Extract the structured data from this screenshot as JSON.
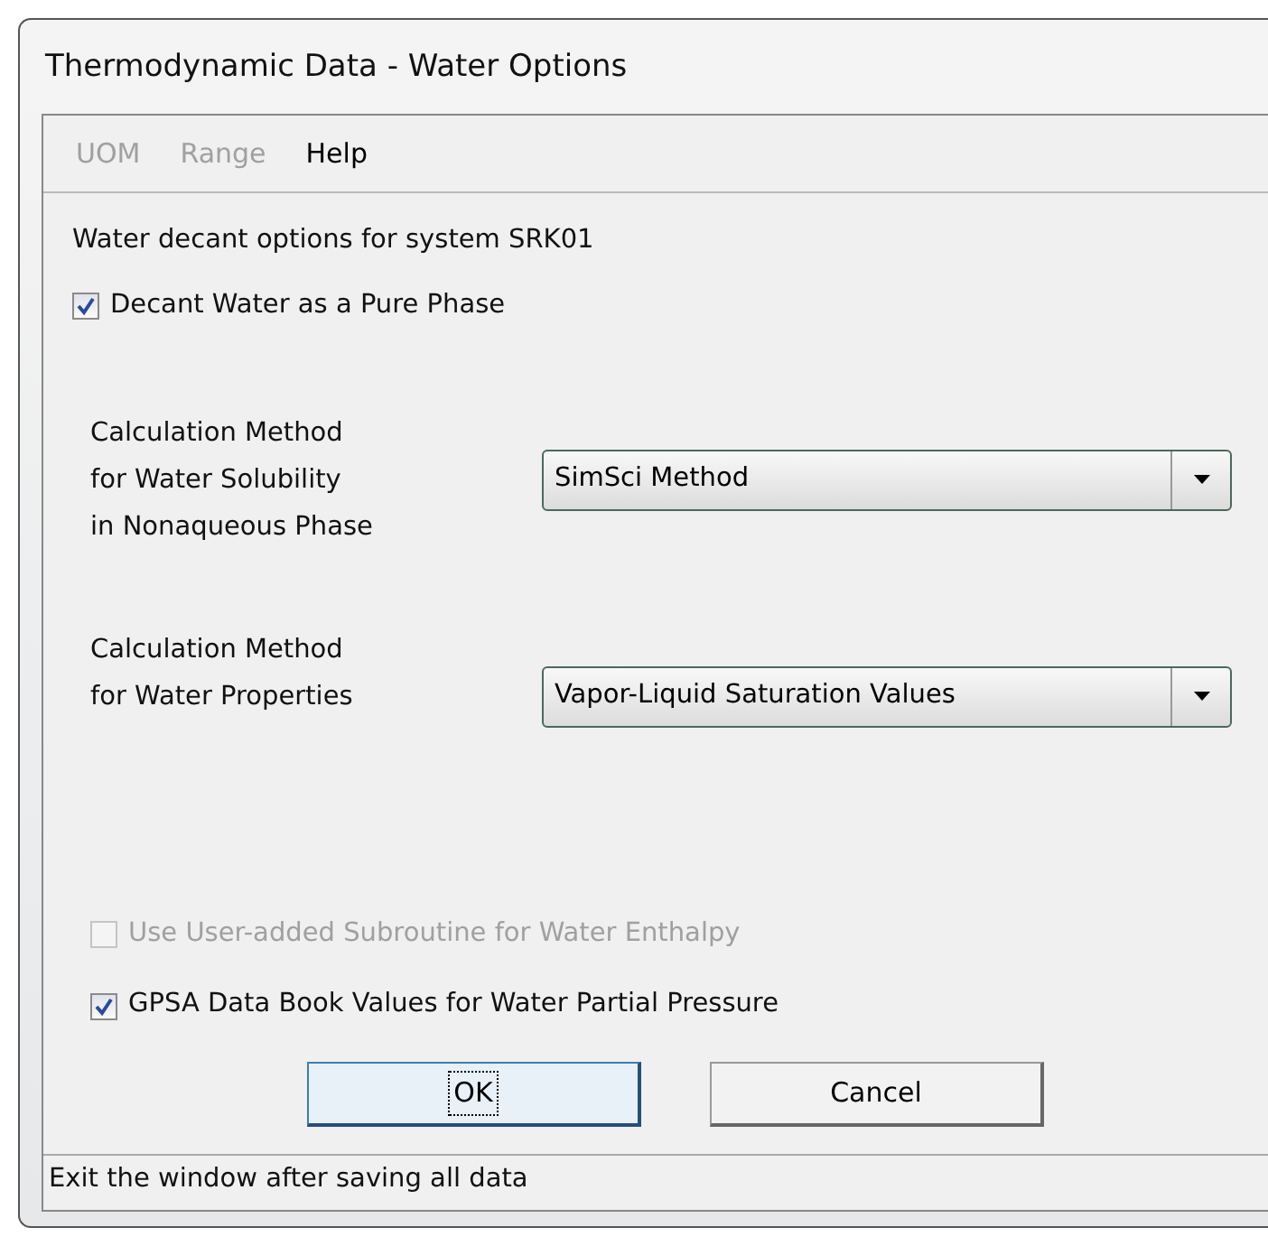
{
  "window": {
    "title": "Thermodynamic Data - Water Options"
  },
  "menu": [
    {
      "label": "UOM",
      "disabled": true
    },
    {
      "label": "Range",
      "disabled": true
    },
    {
      "label": "Help",
      "disabled": false
    }
  ],
  "heading": "Water decant options for system SRK01",
  "decant": {
    "label": "Decant Water as a Pure Phase",
    "checked": true,
    "disabled": false
  },
  "methods": [
    {
      "label": [
        "Calculation Method",
        "for Water Solubility",
        "in Nonaqueous Phase"
      ],
      "value": "SimSci Method"
    },
    {
      "label": [
        "Calculation Method",
        "for Water Properties"
      ],
      "value": "Vapor-Liquid Saturation Values"
    }
  ],
  "options": [
    {
      "label": "Use User-added Subroutine for Water Enthalpy",
      "checked": false,
      "disabled": true
    },
    {
      "label": "GPSA Data Book Values for Water Partial Pressure",
      "checked": true,
      "disabled": false
    }
  ],
  "buttons": [
    {
      "label": "OK",
      "focused": true
    },
    {
      "label": "Cancel",
      "focused": false
    }
  ],
  "status_bar": "Exit the window after saving all data"
}
